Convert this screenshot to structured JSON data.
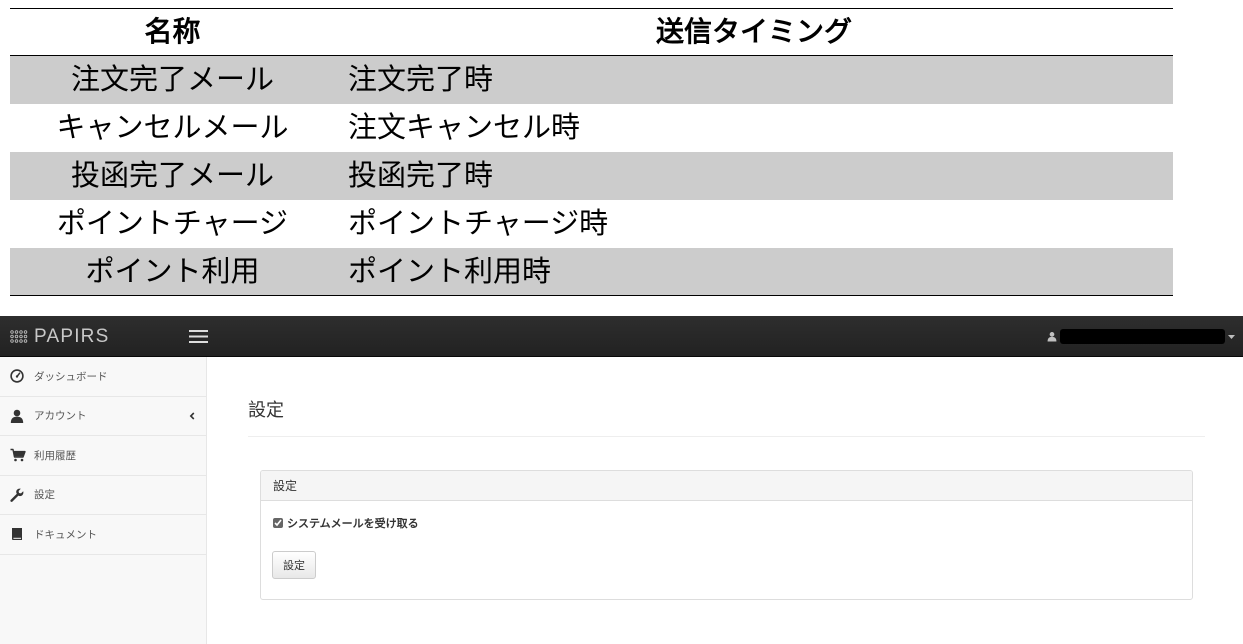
{
  "table": {
    "headers": {
      "name": "名称",
      "timing": "送信タイミング"
    },
    "rows": [
      {
        "name": "注文完了メール",
        "timing": "注文完了時"
      },
      {
        "name": "キャンセルメール",
        "timing": "注文キャンセル時"
      },
      {
        "name": "投函完了メール",
        "timing": "投函完了時"
      },
      {
        "name": "ポイントチャージ",
        "timing": "ポイントチャージ時"
      },
      {
        "name": "ポイント利用",
        "timing": "ポイント利用時"
      }
    ]
  },
  "navbar": {
    "logo_text": "PAPIRS",
    "logo_icon": "dot-grid-icon",
    "menu_icon": "hamburger-icon",
    "user_icon": "user-icon",
    "dropdown_icon": "caret-down-icon"
  },
  "sidebar": {
    "items": [
      {
        "label": "ダッシュボード",
        "icon": "dashboard-icon"
      },
      {
        "label": "アカウント",
        "icon": "user-icon",
        "expand_icon": "chevron-left-icon"
      },
      {
        "label": "利用履歴",
        "icon": "cart-icon"
      },
      {
        "label": "設定",
        "icon": "wrench-icon"
      },
      {
        "label": "ドキュメント",
        "icon": "book-icon"
      }
    ]
  },
  "main": {
    "page_title": "設定",
    "panel": {
      "heading": "設定",
      "checkbox_label": "システムメールを受け取る",
      "checkbox_checked": true,
      "button_label": "設定"
    }
  },
  "colors": {
    "navbar_bg": "#222222",
    "sidebar_bg": "#f8f8f8",
    "table_stripe": "#cccccc",
    "panel_heading_bg": "#f5f5f5"
  }
}
